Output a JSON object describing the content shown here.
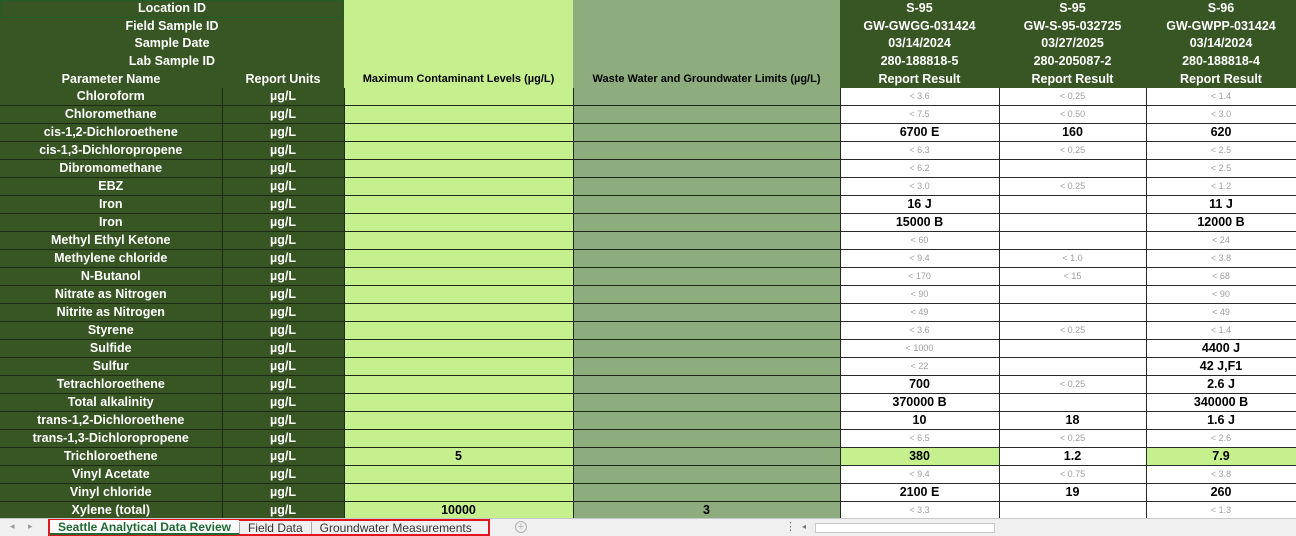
{
  "header": {
    "location_id_label": "Location ID",
    "field_sample_id_label": "Field Sample ID",
    "sample_date_label": "Sample Date",
    "lab_sample_id_label": "Lab Sample ID",
    "parameter_name_label": "Parameter Name",
    "report_units_label": "Report Units",
    "mcl_label": "Maximum Contaminant Levels (µg/L)",
    "wgl_label": "Waste Water and Groundwater Limits (µg/L)"
  },
  "samples": [
    {
      "location": "S-95",
      "field_id": "GW-GWGG-031424",
      "date": "03/14/2024",
      "lab_id": "280-188818-5",
      "result_label": "Report Result"
    },
    {
      "location": "S-95",
      "field_id": "GW-S-95-032725",
      "date": "03/27/2025",
      "lab_id": "280-205087-2",
      "result_label": "Report Result"
    },
    {
      "location": "S-96",
      "field_id": "GW-GWPP-031424",
      "date": "03/14/2024",
      "lab_id": "280-188818-4",
      "result_label": "Report Result"
    }
  ],
  "rows": [
    {
      "name": "Chloroform",
      "unit": "µg/L",
      "mcl": "",
      "wgl": "",
      "r": [
        "< 3.6",
        "< 0.25",
        "< 1.4"
      ],
      "nd": [
        true,
        true,
        true
      ],
      "hl": [
        false,
        false,
        false
      ]
    },
    {
      "name": "Chloromethane",
      "unit": "µg/L",
      "mcl": "",
      "wgl": "",
      "r": [
        "< 7.5",
        "< 0.50",
        "< 3.0"
      ],
      "nd": [
        true,
        true,
        true
      ],
      "hl": [
        false,
        false,
        false
      ]
    },
    {
      "name": "cis-1,2-Dichloroethene",
      "unit": "µg/L",
      "mcl": "",
      "wgl": "",
      "r": [
        "6700 E",
        "160",
        "620"
      ],
      "nd": [
        false,
        false,
        false
      ],
      "hl": [
        false,
        false,
        false
      ]
    },
    {
      "name": "cis-1,3-Dichloropropene",
      "unit": "µg/L",
      "mcl": "",
      "wgl": "",
      "r": [
        "< 6.3",
        "< 0.25",
        "< 2.5"
      ],
      "nd": [
        true,
        true,
        true
      ],
      "hl": [
        false,
        false,
        false
      ]
    },
    {
      "name": "Dibromomethane",
      "unit": "µg/L",
      "mcl": "",
      "wgl": "",
      "r": [
        "< 6.2",
        "",
        "< 2.5"
      ],
      "nd": [
        true,
        false,
        true
      ],
      "hl": [
        false,
        false,
        false
      ]
    },
    {
      "name": "EBZ",
      "unit": "µg/L",
      "mcl": "",
      "wgl": "",
      "r": [
        "< 3.0",
        "< 0.25",
        "< 1.2"
      ],
      "nd": [
        true,
        true,
        true
      ],
      "hl": [
        false,
        false,
        false
      ]
    },
    {
      "name": "Iron",
      "unit": "µg/L",
      "mcl": "",
      "wgl": "",
      "r": [
        "16 J",
        "",
        "11 J"
      ],
      "nd": [
        false,
        false,
        false
      ],
      "hl": [
        false,
        false,
        false
      ]
    },
    {
      "name": "Iron",
      "unit": "µg/L",
      "mcl": "",
      "wgl": "",
      "r": [
        "15000 B",
        "",
        "12000 B"
      ],
      "nd": [
        false,
        false,
        false
      ],
      "hl": [
        false,
        false,
        false
      ]
    },
    {
      "name": "Methyl Ethyl Ketone",
      "unit": "µg/L",
      "mcl": "",
      "wgl": "",
      "r": [
        "< 60",
        "",
        "< 24"
      ],
      "nd": [
        true,
        false,
        true
      ],
      "hl": [
        false,
        false,
        false
      ]
    },
    {
      "name": "Methylene chloride",
      "unit": "µg/L",
      "mcl": "",
      "wgl": "",
      "r": [
        "< 9.4",
        "< 1.0",
        "< 3.8"
      ],
      "nd": [
        true,
        true,
        true
      ],
      "hl": [
        false,
        false,
        false
      ]
    },
    {
      "name": "N-Butanol",
      "unit": "µg/L",
      "mcl": "",
      "wgl": "",
      "r": [
        "< 170",
        "< 15",
        "< 68"
      ],
      "nd": [
        true,
        true,
        true
      ],
      "hl": [
        false,
        false,
        false
      ]
    },
    {
      "name": "Nitrate as Nitrogen",
      "unit": "µg/L",
      "mcl": "",
      "wgl": "",
      "r": [
        "< 90",
        "",
        "< 90"
      ],
      "nd": [
        true,
        false,
        true
      ],
      "hl": [
        false,
        false,
        false
      ]
    },
    {
      "name": "Nitrite as Nitrogen",
      "unit": "µg/L",
      "mcl": "",
      "wgl": "",
      "r": [
        "< 49",
        "",
        "< 49"
      ],
      "nd": [
        true,
        false,
        true
      ],
      "hl": [
        false,
        false,
        false
      ]
    },
    {
      "name": "Styrene",
      "unit": "µg/L",
      "mcl": "",
      "wgl": "",
      "r": [
        "< 3.6",
        "< 0.25",
        "< 1.4"
      ],
      "nd": [
        true,
        true,
        true
      ],
      "hl": [
        false,
        false,
        false
      ]
    },
    {
      "name": "Sulfide",
      "unit": "µg/L",
      "mcl": "",
      "wgl": "",
      "r": [
        "< 1000",
        "",
        "4400 J"
      ],
      "nd": [
        true,
        false,
        false
      ],
      "hl": [
        false,
        false,
        false
      ]
    },
    {
      "name": "Sulfur",
      "unit": "µg/L",
      "mcl": "",
      "wgl": "",
      "r": [
        "< 22",
        "",
        "42 J,F1"
      ],
      "nd": [
        true,
        false,
        false
      ],
      "hl": [
        false,
        false,
        false
      ]
    },
    {
      "name": "Tetrachloroethene",
      "unit": "µg/L",
      "mcl": "",
      "wgl": "",
      "r": [
        "700",
        "< 0.25",
        "2.6 J"
      ],
      "nd": [
        false,
        true,
        false
      ],
      "hl": [
        false,
        false,
        false
      ]
    },
    {
      "name": "Total alkalinity",
      "unit": "µg/L",
      "mcl": "",
      "wgl": "",
      "r": [
        "370000 B",
        "",
        "340000 B"
      ],
      "nd": [
        false,
        false,
        false
      ],
      "hl": [
        false,
        false,
        false
      ]
    },
    {
      "name": "trans-1,2-Dichloroethene",
      "unit": "µg/L",
      "mcl": "",
      "wgl": "",
      "r": [
        "10",
        "18",
        "1.6 J"
      ],
      "nd": [
        false,
        false,
        false
      ],
      "hl": [
        false,
        false,
        false
      ]
    },
    {
      "name": "trans-1,3-Dichloropropene",
      "unit": "µg/L",
      "mcl": "",
      "wgl": "",
      "r": [
        "< 6.5",
        "< 0.25",
        "< 2.6"
      ],
      "nd": [
        true,
        true,
        true
      ],
      "hl": [
        false,
        false,
        false
      ]
    },
    {
      "name": "Trichloroethene",
      "unit": "µg/L",
      "mcl": "5",
      "wgl": "",
      "r": [
        "380",
        "1.2",
        "7.9"
      ],
      "nd": [
        false,
        false,
        false
      ],
      "hl": [
        true,
        false,
        true
      ]
    },
    {
      "name": "Vinyl Acetate",
      "unit": "µg/L",
      "mcl": "",
      "wgl": "",
      "r": [
        "< 9.4",
        "< 0.75",
        "< 3.8"
      ],
      "nd": [
        true,
        true,
        true
      ],
      "hl": [
        false,
        false,
        false
      ]
    },
    {
      "name": "Vinyl chloride",
      "unit": "µg/L",
      "mcl": "",
      "wgl": "",
      "r": [
        "2100 E",
        "19",
        "260"
      ],
      "nd": [
        false,
        false,
        false
      ],
      "hl": [
        false,
        false,
        false
      ]
    },
    {
      "name": "Xylene (total)",
      "unit": "µg/L",
      "mcl": "10000",
      "wgl": "3",
      "r": [
        "< 3.3",
        "",
        "< 1.3"
      ],
      "nd": [
        true,
        false,
        true
      ],
      "hl": [
        false,
        false,
        false
      ]
    }
  ],
  "tabs": {
    "items": [
      {
        "label": "Seattle Analytical Data Review",
        "active": true
      },
      {
        "label": "Field Data",
        "active": false
      },
      {
        "label": "Groundwater Measurements",
        "active": false
      }
    ],
    "add_symbol": "+",
    "nav_prev": "◂",
    "nav_next": "▸",
    "scroll_dots": "⋮",
    "scroll_left": "◂"
  },
  "colors": {
    "header_dark_green": "#375623",
    "mcl_light_green": "#c6ef8e",
    "limits_mid_green": "#8ead7e",
    "exceedance_highlight": "#c6ef8e",
    "active_tab_green": "#1d6b33",
    "annotation_red": "#e0161c"
  }
}
